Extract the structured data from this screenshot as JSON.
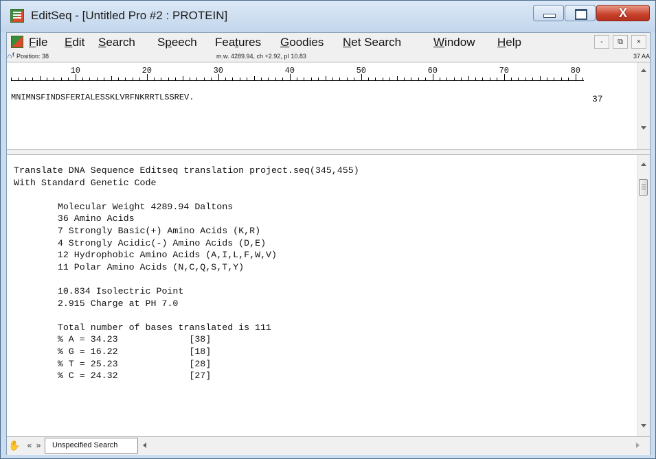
{
  "window": {
    "title": "EditSeq - [Untitled Pro #2 : PROTEIN]",
    "close_glyph": "X"
  },
  "menu": {
    "items": [
      {
        "pre": "",
        "u": "F",
        "post": "ile"
      },
      {
        "pre": "",
        "u": "E",
        "post": "dit"
      },
      {
        "pre": "",
        "u": "S",
        "post": "earch"
      },
      {
        "pre": "S",
        "u": "p",
        "post": "eech"
      },
      {
        "pre": "Fea",
        "u": "t",
        "post": "ures"
      },
      {
        "pre": "",
        "u": "G",
        "post": "oodies"
      },
      {
        "pre": "",
        "u": "N",
        "post": "et Search"
      },
      {
        "pre": "",
        "u": "W",
        "post": "indow"
      },
      {
        "pre": "",
        "u": "H",
        "post": "elp"
      }
    ],
    "mdi_min": "-",
    "mdi_restore": "⧉",
    "mdi_close": "×"
  },
  "status": {
    "position": "Position: 38",
    "stats": "m.w. 4289.94, ch +2.92, pI 10.83",
    "length": "37 AA"
  },
  "ruler": {
    "labels": [
      "10",
      "20",
      "30",
      "40",
      "50",
      "60",
      "70",
      "80"
    ]
  },
  "sequence": {
    "text": "MNIMNSFINDSFERIALESSKLVRFNKRRTLSSREV.",
    "count": "37"
  },
  "report": {
    "lines": [
      "Translate DNA Sequence Editseq translation project.seq(345,455)",
      "With Standard Genetic Code",
      "",
      "        Molecular Weight 4289.94 Daltons",
      "        36 Amino Acids",
      "        7 Strongly Basic(+) Amino Acids (K,R)",
      "        4 Strongly Acidic(-) Amino Acids (D,E)",
      "        12 Hydrophobic Amino Acids (A,I,L,F,W,V)",
      "        11 Polar Amino Acids (N,C,Q,S,T,Y)",
      "",
      "        10.834 Isolectric Point",
      "        2.915 Charge at PH 7.0",
      "",
      "        Total number of bases translated is 111",
      "        % A = 34.23             [38]",
      "        % G = 16.22             [18]",
      "        % T = 25.23             [28]",
      "        % C = 24.32             [27]"
    ]
  },
  "bottom": {
    "search_tab": "Unspecified Search",
    "prev": "«",
    "next": "»"
  },
  "colors": {
    "title_bg": "#c9dcf0",
    "close_button": "#c8402a"
  }
}
